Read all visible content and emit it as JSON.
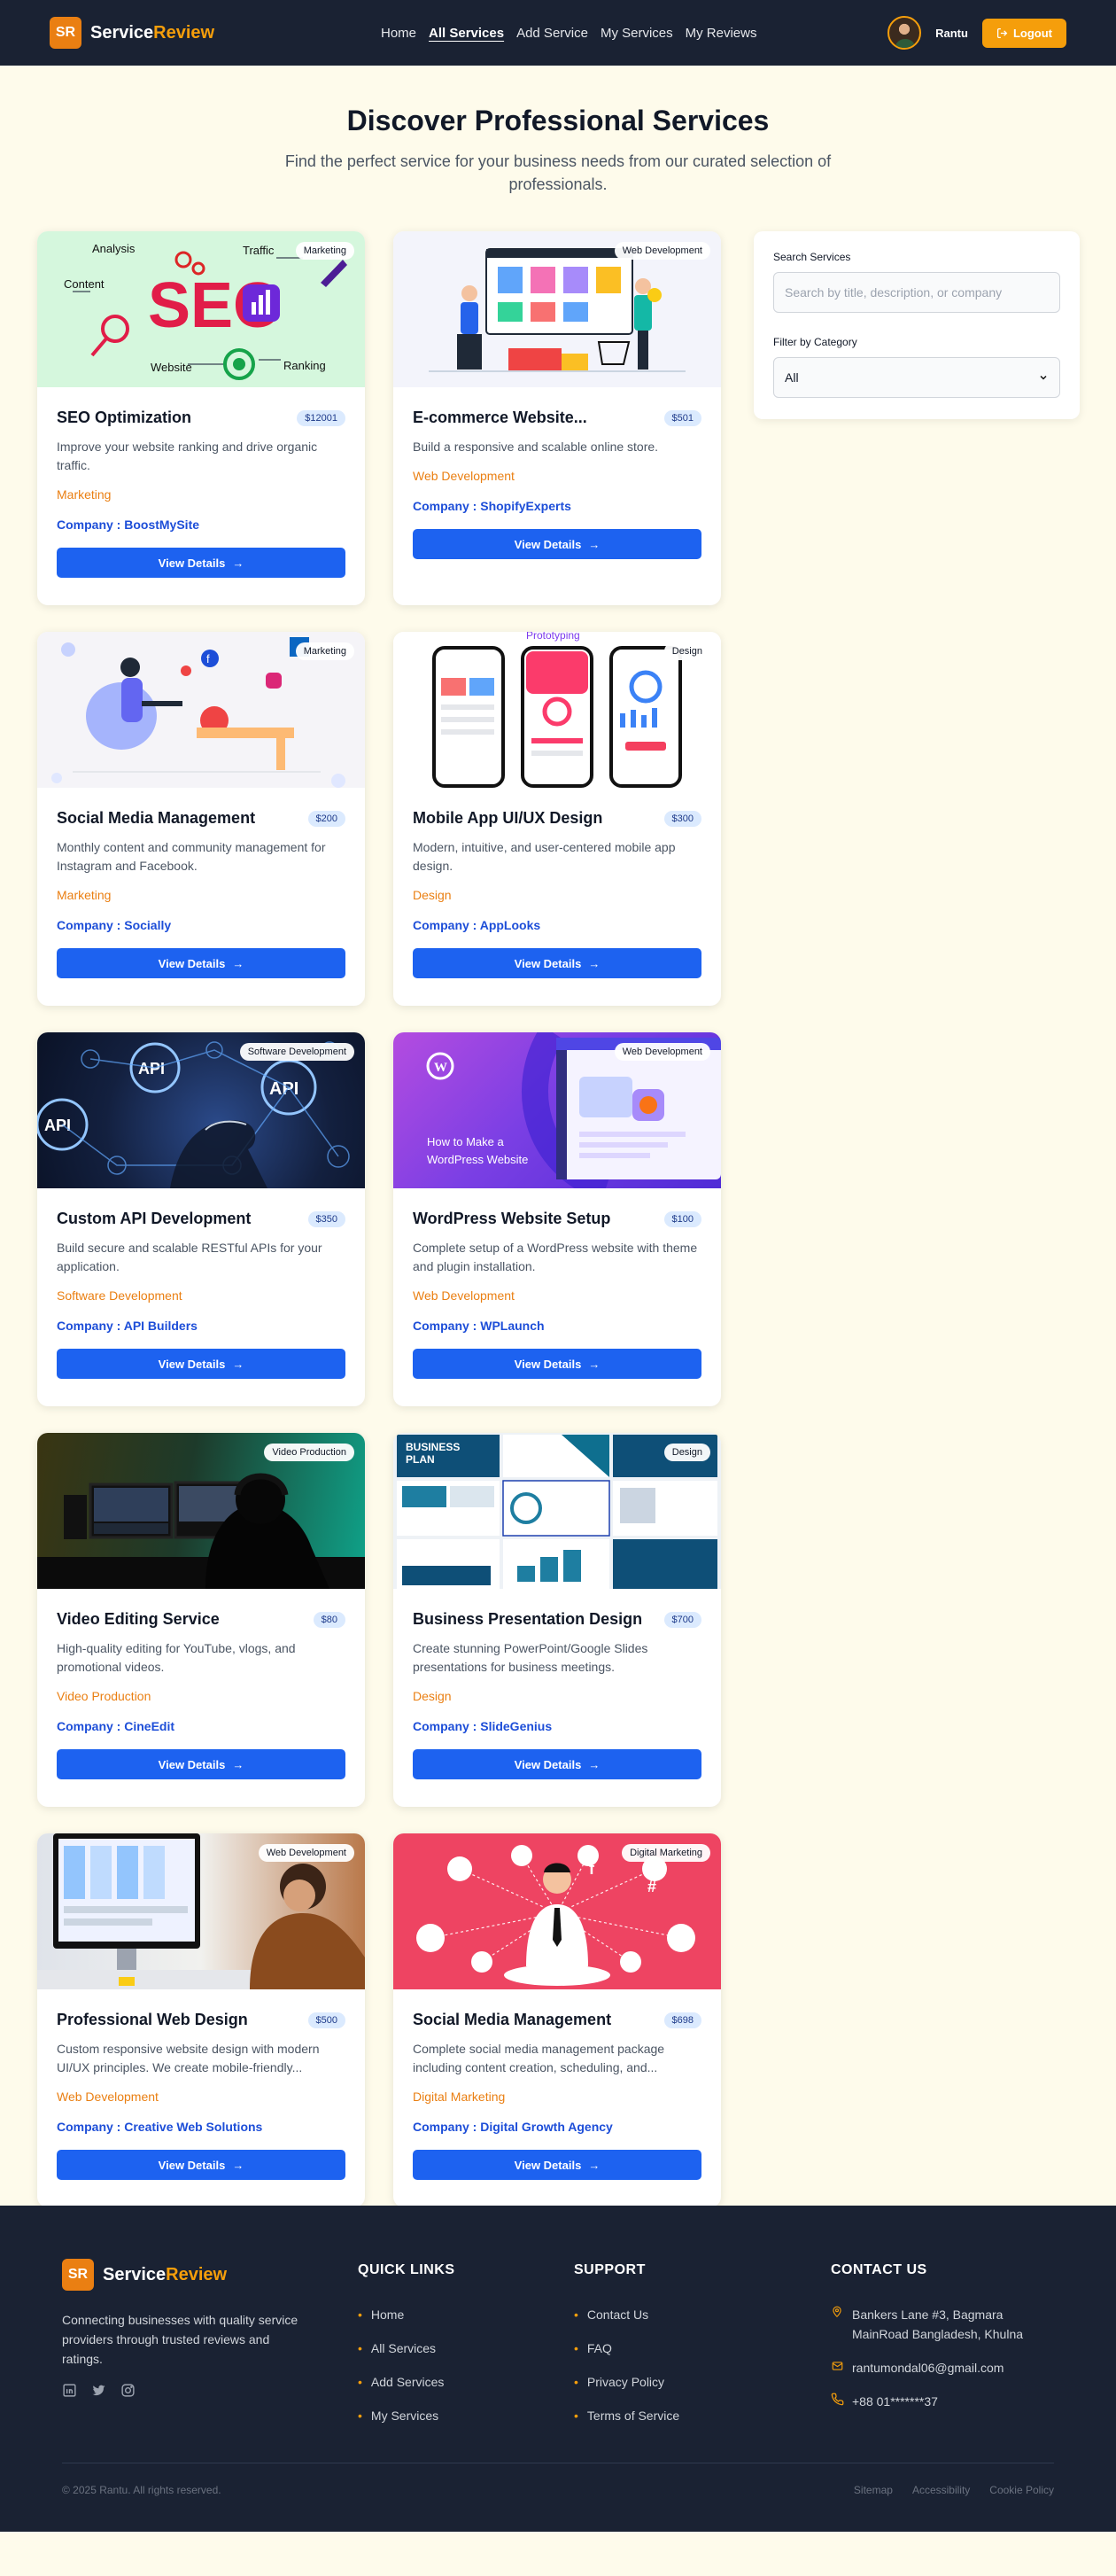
{
  "nav": {
    "logo_badge": "SR",
    "logo_main": "Service",
    "logo_accent": "Review",
    "links": [
      "Home",
      "All Services",
      "Add Service",
      "My Services",
      "My Reviews"
    ],
    "active_link": "All Services",
    "user_name": "Rantu",
    "logout_label": "Logout"
  },
  "hero": {
    "title": "Discover Professional Services",
    "subtitle": "Find the perfect service for your business needs from our curated selection of professionals."
  },
  "services": [
    {
      "title": "SEO Optimization",
      "price": "$12001",
      "badge": "Marketing",
      "desc": "Improve your website ranking and drive organic traffic.",
      "category": "Marketing",
      "company": "Company : BoostMySite",
      "button": "View Details"
    },
    {
      "title": "E-commerce Website...",
      "price": "$501",
      "badge": "Web Development",
      "desc": "Build a responsive and scalable online store.",
      "category": "Web Development",
      "company": "Company : ShopifyExperts",
      "button": "View Details"
    },
    {
      "title": "Social Media Management",
      "price": "$200",
      "badge": "Marketing",
      "desc": "Monthly content and community management for Instagram and Facebook.",
      "category": "Marketing",
      "company": "Company : Socially",
      "button": "View Details"
    },
    {
      "title": "Mobile App UI/UX Design",
      "price": "$300",
      "badge": "Design",
      "desc": "Modern, intuitive, and user-centered mobile app design.",
      "category": "Design",
      "company": "Company : AppLooks",
      "button": "View Details"
    },
    {
      "title": "Custom API Development",
      "price": "$350",
      "badge": "Software Development",
      "desc": "Build secure and scalable RESTful APIs for your application.",
      "category": "Software Development",
      "company": "Company : API Builders",
      "button": "View Details"
    },
    {
      "title": "WordPress Website Setup",
      "price": "$100",
      "badge": "Web Development",
      "desc": "Complete setup of a WordPress website with theme and plugin installation.",
      "category": "Web Development",
      "company": "Company : WPLaunch",
      "button": "View Details"
    },
    {
      "title": "Video Editing Service",
      "price": "$80",
      "badge": "Video Production",
      "desc": "High-quality editing for YouTube, vlogs, and promotional videos.",
      "category": "Video Production",
      "company": "Company : CineEdit",
      "button": "View Details"
    },
    {
      "title": "Business Presentation Design",
      "price": "$700",
      "badge": "Design",
      "desc": "Create stunning PowerPoint/Google Slides presentations for business meetings.",
      "category": "Design",
      "company": "Company : SlideGenius",
      "button": "View Details"
    },
    {
      "title": "Professional Web Design",
      "price": "$500",
      "badge": "Web Development",
      "desc": "Custom responsive website design with modern UI/UX principles. We create mobile-friendly...",
      "category": "Web Development",
      "company": "Company : Creative Web Solutions",
      "button": "View Details"
    },
    {
      "title": "Social Media Management",
      "price": "$698",
      "badge": "Digital Marketing",
      "desc": "Complete social media management package including content creation, scheduling, and...",
      "category": "Digital Marketing",
      "company": "Company : Digital Growth Agency",
      "button": "View Details"
    }
  ],
  "image_text": {
    "seo_big": "SEO",
    "seo_words": [
      "Analysis",
      "Traffic",
      "Content",
      "Website",
      "Ranking"
    ],
    "proto": "Prototyping",
    "api": "API",
    "wp_line1": "How to Make a",
    "wp_line2": "WordPress Website",
    "bp_line1": "BUSINESS",
    "bp_line2": "PLAN"
  },
  "sidebar": {
    "search_label": "Search Services",
    "search_placeholder": "Search by title, description, or company",
    "filter_label": "Filter by Category",
    "filter_value": "All"
  },
  "footer": {
    "logo_badge": "SR",
    "logo_main": "Service",
    "logo_accent": "Review",
    "description": "Connecting businesses with quality service providers through trusted reviews and ratings.",
    "quick_links_title": "QUICK LINKS",
    "quick_links": [
      "Home",
      "All Services",
      "Add Services",
      "My Services"
    ],
    "support_title": "SUPPORT",
    "support_links": [
      "Contact Us",
      "FAQ",
      "Privacy Policy",
      "Terms of Service"
    ],
    "contact_title": "CONTACT US",
    "address": "Bankers Lane #3, Bagmara MainRoad Bangladesh, Khulna",
    "email": "rantumondal06@gmail.com",
    "phone": "+88 01*******37",
    "copyright": "© 2025 Rantu. All rights reserved.",
    "bottom_links": [
      "Sitemap",
      "Accessibility",
      "Cookie Policy"
    ]
  },
  "colors": {
    "navy": "#1a2233",
    "accent_orange": "#f59e0b",
    "primary_blue": "#1d62f0",
    "page_bg": "#fefbeb"
  }
}
